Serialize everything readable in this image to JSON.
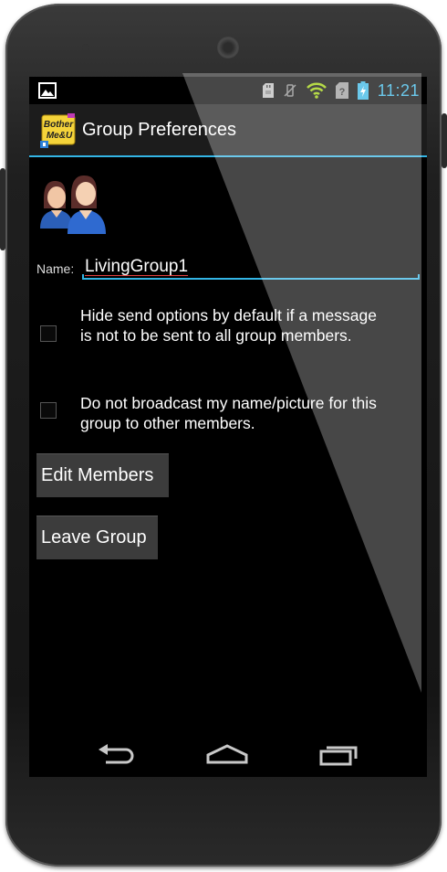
{
  "status_bar": {
    "time": "11:21",
    "icons": [
      "image-notification-icon",
      "sd-card-icon",
      "vibrate-off-icon",
      "wifi-icon",
      "no-sim-icon",
      "battery-charging-icon"
    ]
  },
  "action_bar": {
    "app_icon_text": "Bother Me&U",
    "title": "Group Preferences"
  },
  "form": {
    "name_label": "Name:",
    "name_value": "LivingGroup1",
    "options": [
      {
        "label": "Hide send options by default if a message is not to be sent to all group members.",
        "checked": false
      },
      {
        "label": "Do not broadcast my name/picture for this group to other members.",
        "checked": false
      }
    ],
    "edit_members_label": "Edit Members",
    "leave_group_label": "Leave Group"
  },
  "nav_bar": {
    "icons": [
      "back-icon",
      "home-icon",
      "recent-apps-icon"
    ]
  },
  "colors": {
    "accent": "#33b5e5",
    "background": "#000000",
    "button": "#3c3c3c"
  }
}
